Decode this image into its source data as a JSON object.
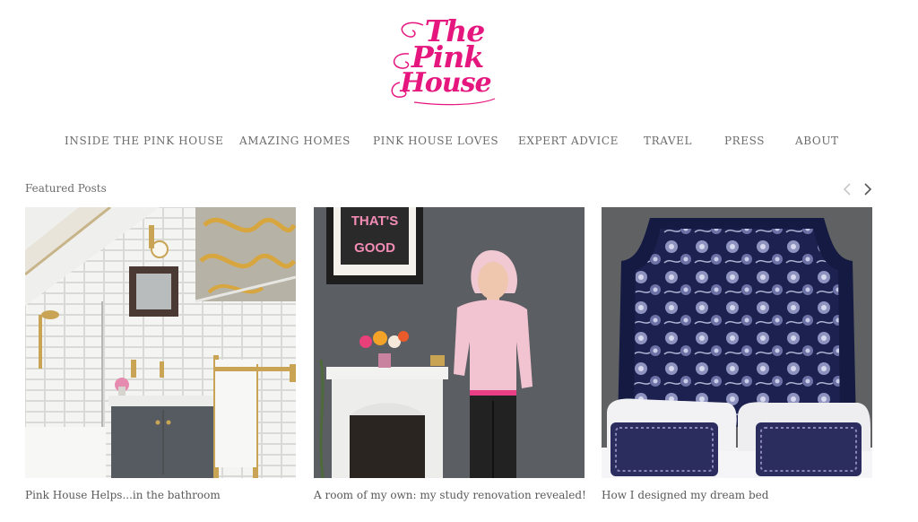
{
  "logo": {
    "line1": "The",
    "line2": "Pink",
    "line3": "House",
    "color": "#e6167f"
  },
  "nav": {
    "items": [
      {
        "label": "INSIDE THE PINK HOUSE"
      },
      {
        "label": "AMAZING HOMES"
      },
      {
        "label": "PINK HOUSE LOVES"
      },
      {
        "label": "EXPERT ADVICE"
      },
      {
        "label": "TRAVEL"
      },
      {
        "label": "PRESS"
      },
      {
        "label": "ABOUT"
      }
    ]
  },
  "featured": {
    "title": "Featured Posts",
    "prev_icon": "chevron-left-icon",
    "next_icon": "chevron-right-icon"
  },
  "posts": [
    {
      "title": "Pink House Helps...in the bathroom",
      "image": "bathroom-photo"
    },
    {
      "title": "A room of my own: my study renovation revealed!",
      "image": "study-portrait-photo",
      "sign_line1": "THAT'S",
      "sign_line2": "GOOD"
    },
    {
      "title": "How I designed my dream bed",
      "image": "floral-headboard-photo"
    }
  ]
}
